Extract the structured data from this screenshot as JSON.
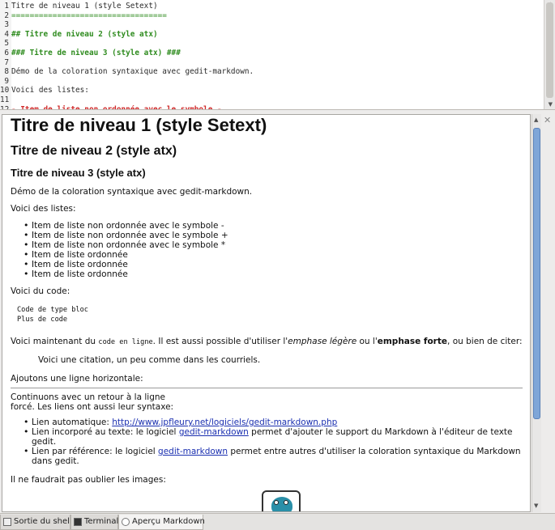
{
  "editor": {
    "lines": [
      {
        "n": "1",
        "text": "Titre de niveau 1 (style Setext)",
        "kind": "code"
      },
      {
        "n": "2",
        "text": "==================================",
        "kind": "setext"
      },
      {
        "n": "3",
        "text": "",
        "kind": "code"
      },
      {
        "n": "4",
        "text": "## Titre de niveau 2 (style atx)",
        "kind": "h"
      },
      {
        "n": "5",
        "text": "",
        "kind": "code"
      },
      {
        "n": "6",
        "text": "### Titre de niveau 3 (style atx) ###",
        "kind": "h"
      },
      {
        "n": "7",
        "text": "",
        "kind": "code"
      },
      {
        "n": "8",
        "text": "Démo de la coloration syntaxique avec gedit-markdown.",
        "kind": "code"
      },
      {
        "n": "9",
        "text": "",
        "kind": "code"
      },
      {
        "n": "10",
        "text": "Voici des listes:",
        "kind": "code"
      },
      {
        "n": "11",
        "text": "",
        "kind": "code"
      },
      {
        "n": "12",
        "text": "- Item de liste non ordonnée avec le symbole -",
        "kind": "bullet"
      }
    ]
  },
  "preview": {
    "h1": "Titre de niveau 1 (style Setext)",
    "h2": "Titre de niveau 2 (style atx)",
    "h3": "Titre de niveau 3 (style atx)",
    "intro": "Démo de la coloration syntaxique avec gedit-markdown.",
    "lists_intro": "Voici des listes:",
    "list_items": [
      "Item de liste non ordonnée avec le symbole -",
      "Item de liste non ordonnée avec le symbole +",
      "Item de liste non ordonnée avec le symbole *",
      "Item de liste ordonnée",
      "Item de liste ordonnée",
      "Item de liste ordonnée"
    ],
    "code_intro": "Voici du code:",
    "code_block_1": "Code de type bloc",
    "code_block_2": "Plus de code",
    "inline_p_1": "Voici maintenant du ",
    "inline_code": "code en ligne",
    "inline_p_2": ". Il est aussi possible d'utiliser l'",
    "em": "emphase légère",
    "inline_p_3": " ou l'",
    "strong": "emphase forte",
    "inline_p_4": ", ou bien de citer:",
    "quote": "Voici une citation, un peu comme dans les courriels.",
    "hr_intro": "Ajoutons une ligne horizontale:",
    "cont_line1": "Continuons avec un retour à la ligne",
    "cont_line2": "forcé. Les liens ont aussi leur syntaxe:",
    "links": [
      {
        "prefix": "Lien automatique: ",
        "link": "http://www.jpfleury.net/logiciels/gedit-markdown.php",
        "suffix": ""
      },
      {
        "prefix": "Lien incorporé au texte: le logiciel ",
        "link": "gedit-markdown",
        "suffix": " permet d'ajouter le support du Markdown à l'éditeur de texte gedit."
      },
      {
        "prefix": "Lien par référence: le logiciel ",
        "link": "gedit-markdown",
        "suffix": " permet entre autres d'utiliser la coloration syntaxique du Markdown dans gedit."
      }
    ],
    "images_intro": "Il ne faudrait pas oublier les images:"
  },
  "tabs": [
    {
      "label": "Sortie du shell",
      "icon": "shell-output-icon"
    },
    {
      "label": "Terminal",
      "icon": "terminal-icon"
    },
    {
      "label": "Aperçu Markdown",
      "icon": "markdown-preview-icon",
      "active": true
    }
  ],
  "colors": {
    "heading_syntax": "#2e8b1e",
    "bullet_syntax": "#d02a2a",
    "link": "#1a2fb0",
    "scrollbar_thumb": "#7fa6d8"
  }
}
